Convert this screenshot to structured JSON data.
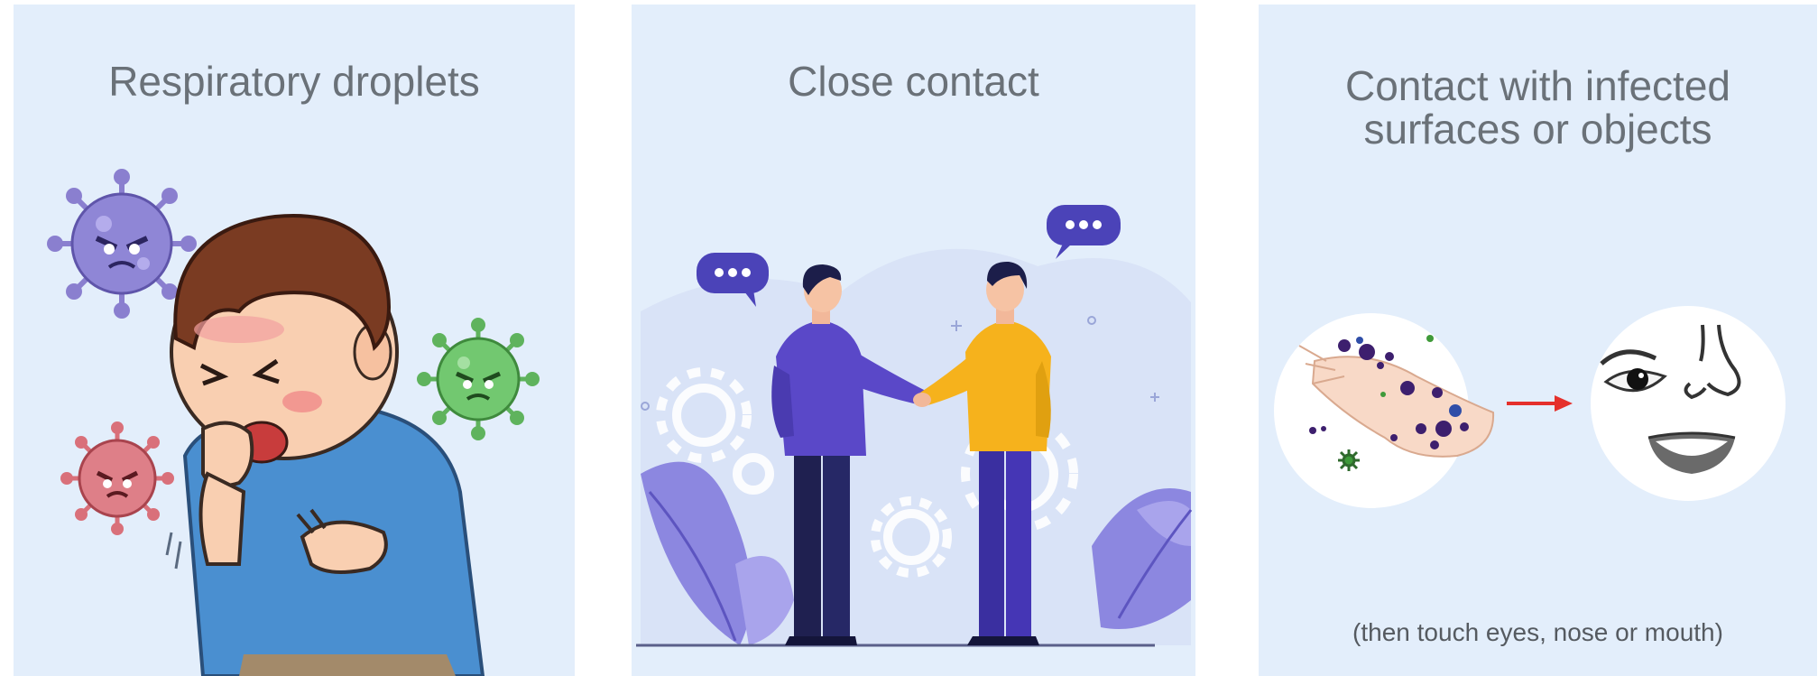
{
  "panels": [
    {
      "title": "Respiratory droplets"
    },
    {
      "title": "Close contact"
    },
    {
      "title_line1": "Contact with infected",
      "title_line2": "surfaces or objects",
      "caption": "(then touch eyes, nose or mouth)"
    }
  ],
  "colors": {
    "panel_bg": "#e3eefb",
    "title_text": "#6a7178",
    "arrow": "#e5302b",
    "virus_purple": "#8a7fcf",
    "virus_green": "#6cc36a",
    "virus_red": "#d9707a",
    "shirt_blue": "#4a8fd0",
    "person1_shirt": "#5a48c8",
    "person2_shirt": "#f6b21c",
    "speech_bubble": "#4b43b8"
  },
  "icons": [
    "virus-icon",
    "speech-bubble-icon",
    "gear-icon",
    "leaf-icon",
    "eye-icon",
    "nose-icon",
    "mouth-icon",
    "arrow-right-icon"
  ]
}
